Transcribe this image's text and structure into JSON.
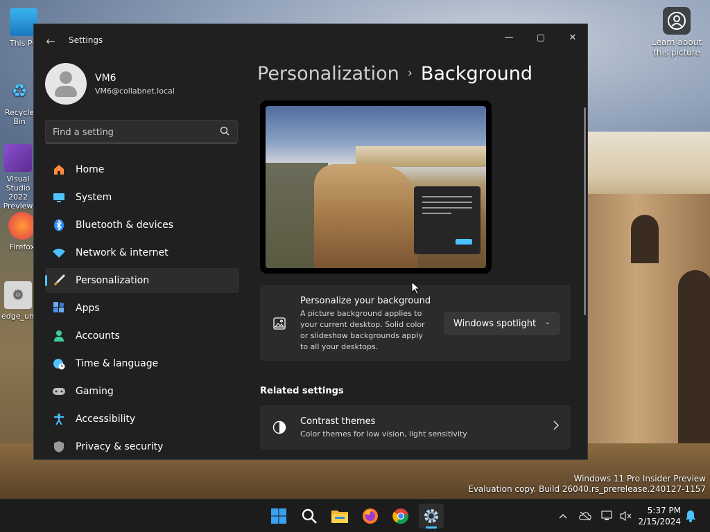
{
  "window": {
    "app_title": "Settings",
    "back_glyph": "←",
    "minimize_glyph": "—",
    "maximize_glyph": "▢",
    "close_glyph": "✕"
  },
  "profile": {
    "name": "VM6",
    "email": "VM6@collabnet.local"
  },
  "search": {
    "placeholder": "Find a setting",
    "icon": "search-icon"
  },
  "sidebar": {
    "items": [
      {
        "label": "Home",
        "icon": "home-icon",
        "color": "#ff8a3c"
      },
      {
        "label": "System",
        "icon": "monitor-icon",
        "color": "#4cc2ff"
      },
      {
        "label": "Bluetooth & devices",
        "icon": "bluetooth-icon",
        "color": "#2f8fff"
      },
      {
        "label": "Network & internet",
        "icon": "wifi-icon",
        "color": "#4cc2ff"
      },
      {
        "label": "Personalization",
        "icon": "brush-icon",
        "color": "#e0a040"
      },
      {
        "label": "Apps",
        "icon": "apps-icon",
        "color": "#4a90e2"
      },
      {
        "label": "Accounts",
        "icon": "person-icon",
        "color": "#3ccf9f"
      },
      {
        "label": "Time & language",
        "icon": "globe-clock-icon",
        "color": "#4cc2ff"
      },
      {
        "label": "Gaming",
        "icon": "gamepad-icon",
        "color": "#bfbfbf"
      },
      {
        "label": "Accessibility",
        "icon": "accessibility-icon",
        "color": "#4cc2ff"
      },
      {
        "label": "Privacy & security",
        "icon": "shield-icon",
        "color": "#9a9a9a"
      }
    ],
    "active_index": 4
  },
  "breadcrumb": {
    "parent": "Personalization",
    "separator": "›",
    "current": "Background"
  },
  "background_card": {
    "title": "Personalize your background",
    "description": "A picture background applies to your current desktop. Solid color or slideshow backgrounds apply to all your desktops.",
    "dropdown_value": "Windows spotlight",
    "icon": "picture-icon"
  },
  "related": {
    "heading": "Related settings",
    "contrast_title": "Contrast themes",
    "contrast_desc": "Color themes for low vision, light sensitivity",
    "icon": "contrast-icon"
  },
  "desktop": {
    "icons": [
      "This PC",
      "Recycle Bin",
      "Visual Studio 2022 Preview",
      "Firefox",
      "edge_uninstall"
    ],
    "learn_label": "Learn about this picture",
    "watermark_line1": "Windows 11 Pro Insider Preview",
    "watermark_line2": "Evaluation copy. Build 26040.rs_prerelease.240127-1157"
  },
  "taskbar": {
    "apps": [
      "start-icon",
      "search-icon",
      "file-explorer-icon",
      "firefox-icon",
      "chrome-icon",
      "settings-icon"
    ],
    "time": "5:37 PM",
    "date": "2/15/2024"
  },
  "colors": {
    "accent": "#4cc2ff",
    "window_bg": "#202020",
    "card_bg": "#2b2b2b"
  }
}
